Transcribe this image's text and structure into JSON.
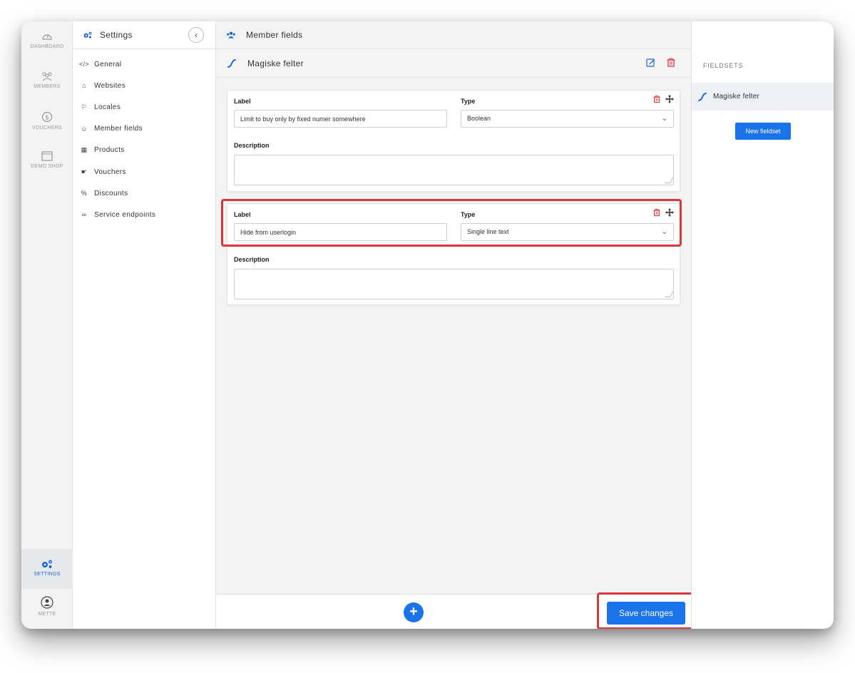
{
  "rail": {
    "items": [
      {
        "label": "DASHBOARD",
        "icon": "dashboard-icon"
      },
      {
        "label": "MEMBERS",
        "icon": "members-icon"
      },
      {
        "label": "VOUCHERS",
        "icon": "vouchers-icon"
      },
      {
        "label": "DEMO SHOP",
        "icon": "shop-icon"
      }
    ],
    "settings_label": "SETTINGS",
    "user_label": "METTE"
  },
  "nav": {
    "title": "Settings",
    "items": [
      {
        "label": "General",
        "icon": "code-icon"
      },
      {
        "label": "Websites",
        "icon": "home-icon"
      },
      {
        "label": "Locales",
        "icon": "flag-icon"
      },
      {
        "label": "Member fields",
        "icon": "users-icon"
      },
      {
        "label": "Products",
        "icon": "boxes-icon"
      },
      {
        "label": "Vouchers",
        "icon": "hand-icon"
      },
      {
        "label": "Discounts",
        "icon": "percent-icon"
      },
      {
        "label": "Service endpoints",
        "icon": "link-icon"
      }
    ]
  },
  "main": {
    "title": "Member fields",
    "fieldset_title": "Magiske felter",
    "fields": [
      {
        "label_title": "Label",
        "label_value": "Limit to buy only by fixed numer somewhere",
        "type_title": "Type",
        "type_value": "Boolean",
        "description_title": "Description",
        "description_value": ""
      },
      {
        "label_title": "Label",
        "label_value": "Hide from userlogin",
        "type_title": "Type",
        "type_value": "Single line text",
        "description_title": "Description",
        "description_value": ""
      }
    ],
    "add_label": "+",
    "save_label": "Save changes"
  },
  "right": {
    "section_title": "FIELDSETS",
    "fieldset_item": "Magiske felter",
    "new_button": "New fieldset"
  },
  "colors": {
    "accent": "#1a73e8",
    "danger": "#d9363e",
    "highlight": "#d9363e"
  }
}
